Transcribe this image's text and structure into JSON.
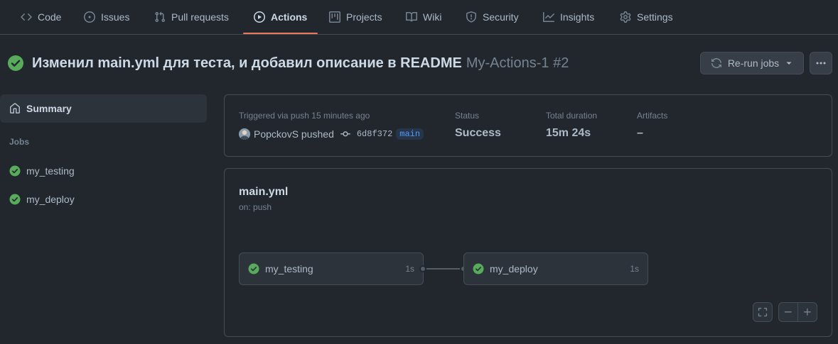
{
  "nav": {
    "tabs": [
      {
        "label": "Code",
        "icon": "code-icon"
      },
      {
        "label": "Issues",
        "icon": "issue-icon"
      },
      {
        "label": "Pull requests",
        "icon": "pull-request-icon"
      },
      {
        "label": "Actions",
        "icon": "play-icon",
        "active": true
      },
      {
        "label": "Projects",
        "icon": "project-icon"
      },
      {
        "label": "Wiki",
        "icon": "book-icon"
      },
      {
        "label": "Security",
        "icon": "shield-icon"
      },
      {
        "label": "Insights",
        "icon": "graph-icon"
      },
      {
        "label": "Settings",
        "icon": "gear-icon"
      }
    ]
  },
  "run": {
    "title": "Изменил main.yml для теста, и добавил описание в README",
    "workflow_run": "My-Actions-1 #2",
    "rerun_label": "Re-run jobs",
    "status_icon": "check-circle-icon"
  },
  "sidebar": {
    "summary_label": "Summary",
    "jobs_heading": "Jobs",
    "jobs": [
      {
        "label": "my_testing",
        "status": "success"
      },
      {
        "label": "my_deploy",
        "status": "success"
      }
    ]
  },
  "summary": {
    "triggered_label": "Triggered via push 15 minutes ago",
    "actor": "PopckovS pushed",
    "commit": "6d8f372",
    "branch": "main",
    "status_label": "Status",
    "status_value": "Success",
    "duration_label": "Total duration",
    "duration_value": "15m 24s",
    "artifacts_label": "Artifacts",
    "artifacts_value": "–"
  },
  "graph": {
    "workflow_file": "main.yml",
    "trigger": "on: push",
    "jobs": [
      {
        "label": "my_testing",
        "duration": "1s"
      },
      {
        "label": "my_deploy",
        "duration": "1s"
      }
    ]
  },
  "colors": {
    "bg": "#22272e",
    "success": "#57ab5a",
    "accent_underline": "#ec775c",
    "link": "#539bf5"
  }
}
